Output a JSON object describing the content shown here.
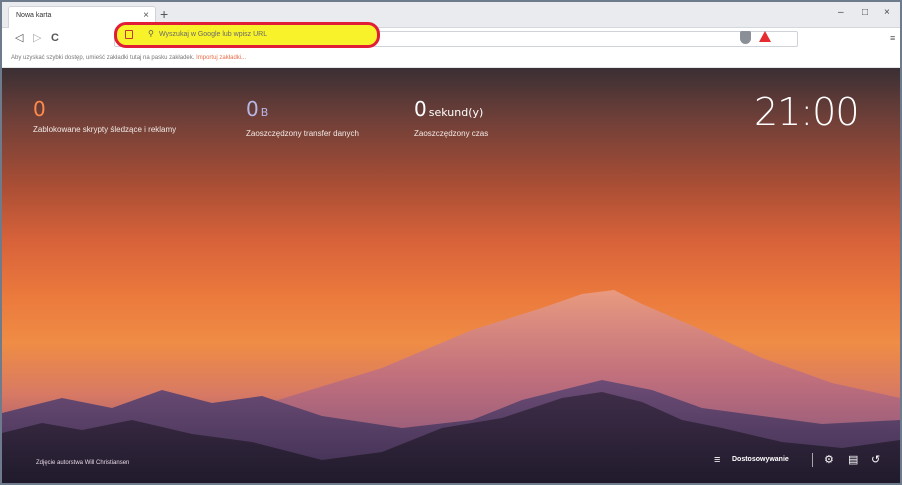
{
  "tab": {
    "title": "Nowa karta",
    "close": "×",
    "new_tab": "+"
  },
  "window": {
    "minimize": "–",
    "maximize": "□",
    "close": "×"
  },
  "toolbar": {
    "back": "◁",
    "forward": "▷",
    "reload": "C",
    "menu": "≡"
  },
  "address": {
    "placeholder": "Wyszukaj w Google lub wpisz URL",
    "search_glyph": "⚲"
  },
  "bookmarks_bar": {
    "text": "Aby uzyskać szybki dostęp, umieść zakładki tutaj na pasku zakładek.",
    "link": "Importuj zakładki..."
  },
  "stats": [
    {
      "value": "0",
      "unit": "",
      "label": "Zablokowane skrypty śledzące i reklamy"
    },
    {
      "value": "0",
      "unit": "B",
      "label": "Zaoszczędzony transfer danych"
    },
    {
      "value": "0",
      "unit": "sekund(y)",
      "label": "Zaoszczędzony czas"
    }
  ],
  "clock": "21:00",
  "photo_credit": "Zdjęcie autorstwa Will Christiansen",
  "footer": {
    "customize": "Dostosowywanie",
    "customize_icon": "≡",
    "settings_icon": "⚙",
    "bookmarks_icon": "▤",
    "history_icon": "↺"
  },
  "colors": {
    "highlight_fill": "#f7f22a",
    "highlight_border": "#e01e37",
    "stat_orange": "#ff8a4a",
    "stat_lavender": "#b9b6e6",
    "brave_red": "#e52c32"
  }
}
